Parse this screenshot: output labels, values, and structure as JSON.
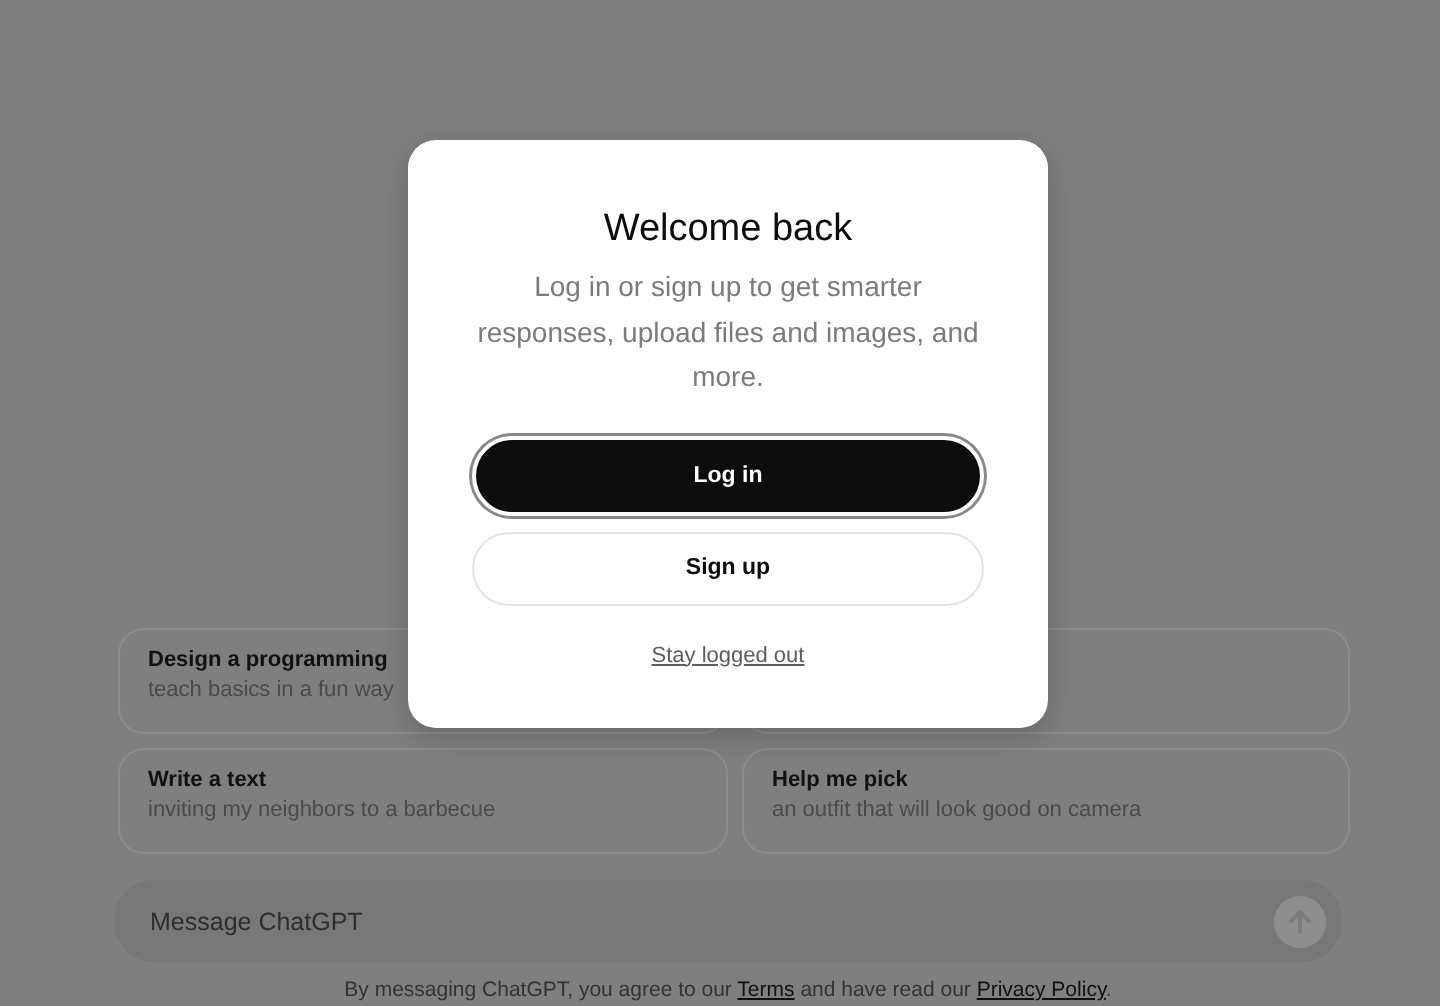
{
  "suggestions": [
    {
      "kind": "prompt",
      "title": "Design a programming",
      "subtitle": "teach basics in a fun way"
    },
    {
      "kind": "covered"
    },
    {
      "kind": "prompt",
      "title": "Write a text",
      "subtitle": "inviting my neighbors to a barbecue"
    },
    {
      "kind": "prompt",
      "title": "Help me pick",
      "subtitle": "an outfit that will look good on camera"
    }
  ],
  "composer": {
    "placeholder": "Message ChatGPT"
  },
  "footer": {
    "before": "By messaging ChatGPT, you agree to our",
    "terms_link": "Terms",
    "middle": "and have read our",
    "privacy_link": "Privacy Policy",
    "after": "."
  },
  "dialog": {
    "title": "Welcome back",
    "message": "Log in or sign up to get smarter responses, upload files and images, and more.",
    "buttons": [
      {
        "label": "Log in",
        "kind": "primary"
      },
      {
        "label": "Sign up",
        "kind": "secondary"
      }
    ],
    "link": "Stay logged out"
  }
}
